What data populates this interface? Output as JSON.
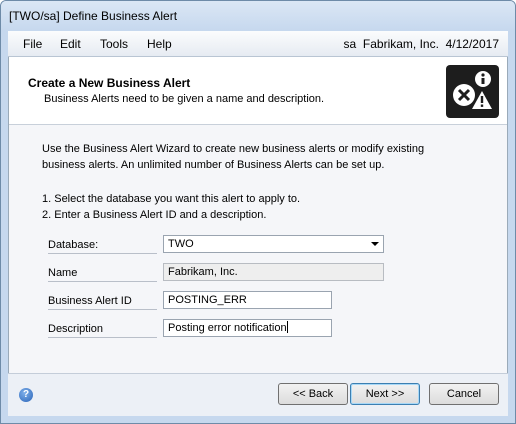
{
  "window": {
    "title": "[TWO/sa] Define Business Alert"
  },
  "menu": {
    "items": [
      "File",
      "Edit",
      "Tools",
      "Help"
    ],
    "user": "sa",
    "company": "Fabrikam, Inc.",
    "date": "4/12/2017"
  },
  "header": {
    "title": "Create a New Business Alert",
    "subtitle": "Business Alerts need to be given a name and description.",
    "icon": "business-alert-icon"
  },
  "body": {
    "intro_line1": "Use the Business Alert Wizard to create new business alerts or modify existing",
    "intro_line2": "business alerts. An unlimited number of Business Alerts can be set up.",
    "step1": "1. Select the database you want this alert to apply to.",
    "step2": "2. Enter a Business Alert ID and a description."
  },
  "form": {
    "database": {
      "label": "Database:",
      "value": "TWO"
    },
    "name": {
      "label": "Name",
      "value": "Fabrikam, Inc."
    },
    "alert_id": {
      "label": "Business Alert ID",
      "value": "POSTING_ERR"
    },
    "description": {
      "label": "Description",
      "value": "Posting error notification"
    }
  },
  "footer": {
    "help_icon": "help-icon",
    "back_label": "<< Back",
    "next_label": "Next >>",
    "cancel_label": "Cancel"
  }
}
